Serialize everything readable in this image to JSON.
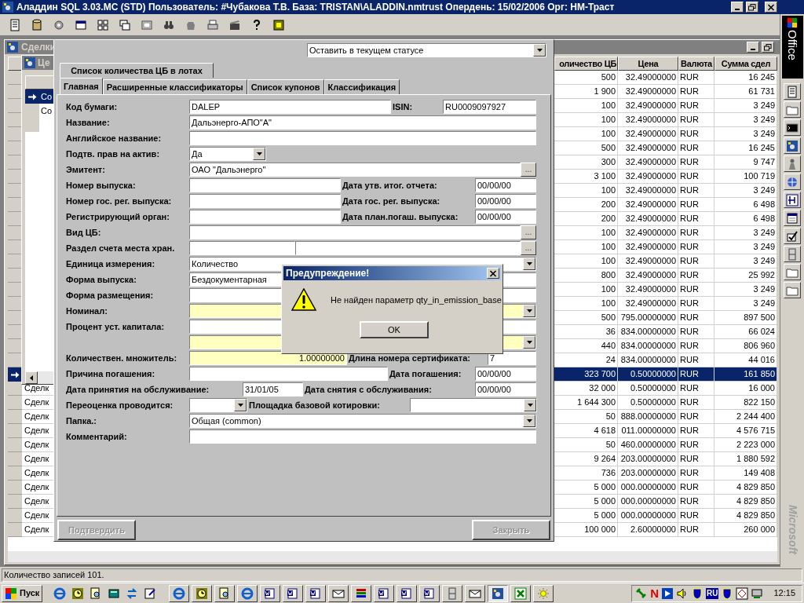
{
  "app_window": {
    "title": "Аладдин SQL 3.03.MC (STD)  Пользователь: #Чубакова Т.В. База: TRISTAN\\ALADDIN.nmtrust Опердень: 15/02/2006 Орг: НМ-Траст"
  },
  "deals_window": {
    "title": "Сделки",
    "columns": [
      "оличество ЦБ",
      "Цена",
      "Валюта",
      "Сумма сдел"
    ],
    "rows": [
      {
        "quantity": "500",
        "price": "32.49000000",
        "currency": "RUR",
        "amount": "16 245",
        "selected": false
      },
      {
        "quantity": "1 900",
        "price": "32.49000000",
        "currency": "RUR",
        "amount": "61 731",
        "selected": false
      },
      {
        "quantity": "100",
        "price": "32.49000000",
        "currency": "RUR",
        "amount": "3 249",
        "selected": false
      },
      {
        "quantity": "100",
        "price": "32.49000000",
        "currency": "RUR",
        "amount": "3 249",
        "selected": false
      },
      {
        "quantity": "100",
        "price": "32.49000000",
        "currency": "RUR",
        "amount": "3 249",
        "selected": false
      },
      {
        "quantity": "500",
        "price": "32.49000000",
        "currency": "RUR",
        "amount": "16 245",
        "selected": false
      },
      {
        "quantity": "300",
        "price": "32.49000000",
        "currency": "RUR",
        "amount": "9 747",
        "selected": false
      },
      {
        "quantity": "3 100",
        "price": "32.49000000",
        "currency": "RUR",
        "amount": "100 719",
        "selected": false
      },
      {
        "quantity": "100",
        "price": "32.49000000",
        "currency": "RUR",
        "amount": "3 249",
        "selected": false
      },
      {
        "quantity": "200",
        "price": "32.49000000",
        "currency": "RUR",
        "amount": "6 498",
        "selected": false
      },
      {
        "quantity": "200",
        "price": "32.49000000",
        "currency": "RUR",
        "amount": "6 498",
        "selected": false
      },
      {
        "quantity": "100",
        "price": "32.49000000",
        "currency": "RUR",
        "amount": "3 249",
        "selected": false
      },
      {
        "quantity": "100",
        "price": "32.49000000",
        "currency": "RUR",
        "amount": "3 249",
        "selected": false
      },
      {
        "quantity": "100",
        "price": "32.49000000",
        "currency": "RUR",
        "amount": "3 249",
        "selected": false
      },
      {
        "quantity": "800",
        "price": "32.49000000",
        "currency": "RUR",
        "amount": "25 992",
        "selected": false
      },
      {
        "quantity": "100",
        "price": "32.49000000",
        "currency": "RUR",
        "amount": "3 249",
        "selected": false
      },
      {
        "quantity": "100",
        "price": "32.49000000",
        "currency": "RUR",
        "amount": "3 249",
        "selected": false
      },
      {
        "quantity": "500",
        "price": "795.00000000",
        "currency": "RUR",
        "amount": "897 500",
        "selected": false
      },
      {
        "quantity": "36",
        "price": "834.00000000",
        "currency": "RUR",
        "amount": "66 024",
        "selected": false
      },
      {
        "quantity": "440",
        "price": "834.00000000",
        "currency": "RUR",
        "amount": "806 960",
        "selected": false
      },
      {
        "quantity": "24",
        "price": "834.00000000",
        "currency": "RUR",
        "amount": "44 016",
        "selected": false
      },
      {
        "quantity": "323 700",
        "price": "0.50000000",
        "currency": "RUR",
        "amount": "161 850",
        "selected": true
      },
      {
        "column_1": "Сделк",
        "quantity": "32 000",
        "price": "0.50000000",
        "currency": "RUR",
        "amount": "16 000",
        "selected": false
      },
      {
        "column_1": "Сделк",
        "quantity": "1 644 300",
        "price": "0.50000000",
        "currency": "RUR",
        "amount": "822 150",
        "selected": false
      },
      {
        "column_1": "Сделк",
        "quantity": "50",
        "price": "888.00000000",
        "currency": "RUR",
        "amount": "2 244 400",
        "selected": false
      },
      {
        "column_1": "Сделк",
        "quantity": "4 618",
        "price": "011.00000000",
        "currency": "RUR",
        "amount": "4 576 715",
        "selected": false
      },
      {
        "column_1": "Сделк",
        "quantity": "50",
        "price": "460.00000000",
        "currency": "RUR",
        "amount": "2 223 000",
        "selected": false
      },
      {
        "column_1": "Сделк",
        "quantity": "9 264",
        "price": "203.00000000",
        "currency": "RUR",
        "amount": "1 880 592",
        "selected": false
      },
      {
        "column_1": "Сделк",
        "quantity": "736",
        "price": "203.00000000",
        "currency": "RUR",
        "amount": "149 408",
        "selected": false
      },
      {
        "column_1": "Сделк",
        "quantity": "5 000",
        "price": "000.00000000",
        "currency": "RUR",
        "amount": "4 829 850",
        "selected": false
      },
      {
        "column_1": "Сделк",
        "quantity": "5 000",
        "price": "000.00000000",
        "currency": "RUR",
        "amount": "4 829 850",
        "selected": false
      },
      {
        "column_1": "Сделк",
        "quantity": "5 000",
        "price": "000.00000000",
        "currency": "RUR",
        "amount": "4 829 850",
        "selected": false
      },
      {
        "column_1": "Сделк",
        "quantity": "100 000",
        "price": "2.60000000",
        "currency": "RUR",
        "amount": "260 000",
        "selected": false
      }
    ]
  },
  "securities_window": {
    "title": "Це",
    "rows": [
      {
        "text": "Со",
        "selected": true
      },
      {
        "text": "Со",
        "selected": false
      }
    ]
  },
  "dialog": {
    "status_combo": "Оставить в текущем статусе",
    "tab_rows": [
      [
        {
          "label": "Список количества ЦБ в лотах",
          "selected": false
        }
      ],
      [
        {
          "label": "Главная",
          "selected": true
        },
        {
          "label": "Расширенные классификаторы",
          "selected": false
        },
        {
          "label": "Список купонов",
          "selected": false
        },
        {
          "label": "Классификация",
          "selected": false
        }
      ]
    ],
    "form_rows": [
      [
        {
          "kind": "label",
          "text": "Код бумаги:"
        },
        {
          "kind": "field",
          "value": "DALEP",
          "required": false
        },
        {
          "kind": "label",
          "text": "ISIN:"
        },
        {
          "kind": "field",
          "value": "RU0009097927",
          "required": false
        }
      ],
      [
        {
          "kind": "label",
          "text": "Название:"
        },
        {
          "kind": "field",
          "value": "Дальэнерго-АПО\"А\"",
          "required": false
        }
      ],
      [
        {
          "kind": "label",
          "text": "Английское название:"
        },
        {
          "kind": "field",
          "required": false
        }
      ],
      [
        {
          "kind": "label",
          "text": "Подтв. прав на актив:"
        },
        {
          "kind": "combo",
          "value": "Да",
          "required": false
        }
      ],
      [
        {
          "kind": "label",
          "text": "Эмитент:"
        },
        {
          "kind": "field",
          "value": "ОАО \"Дальэнерго\"",
          "required": false
        },
        {
          "kind": "browse",
          "text": "..."
        }
      ],
      [
        {
          "kind": "label",
          "text": "Номер выпуска:"
        },
        {
          "kind": "field",
          "required": false
        },
        {
          "kind": "label",
          "text": "Дата утв. итог. отчета:"
        },
        {
          "kind": "field",
          "value": "00/00/00",
          "required": false
        }
      ],
      [
        {
          "kind": "label",
          "text": "Номер гос. рег. выпуска:"
        },
        {
          "kind": "field",
          "required": false
        },
        {
          "kind": "label",
          "text": "Дата гос. рег. выпуска:"
        },
        {
          "kind": "field",
          "value": "00/00/00",
          "required": false
        }
      ],
      [
        {
          "kind": "label",
          "text": "Регистрирующий орган:"
        },
        {
          "kind": "field",
          "required": false
        },
        {
          "kind": "label",
          "text": "Дата план.погаш. выпуска:"
        },
        {
          "kind": "field",
          "value": "00/00/00",
          "required": false
        }
      ],
      [
        {
          "kind": "label",
          "text": "Вид ЦБ:"
        },
        {
          "kind": "field",
          "required": false
        },
        {
          "kind": "browse",
          "text": "..."
        }
      ],
      [
        {
          "kind": "label",
          "text": "Раздел счета места хран."
        },
        {
          "kind": "field",
          "required": false
        },
        {
          "kind": "field",
          "required": false
        },
        {
          "kind": "browse",
          "text": "..."
        }
      ],
      [
        {
          "kind": "label",
          "text": "Единица измерения:"
        },
        {
          "kind": "combo",
          "value": "Количество",
          "required": false
        }
      ],
      [
        {
          "kind": "label",
          "text": "Форма выпуска:"
        },
        {
          "kind": "field",
          "value": "Бездокументарная",
          "required": false
        }
      ],
      [
        {
          "kind": "label",
          "text": "Форма размещения:"
        },
        {
          "kind": "field",
          "required": false
        }
      ],
      [
        {
          "kind": "label",
          "text": "Номинал:"
        },
        {
          "kind": "combo",
          "required": true
        }
      ],
      [
        {
          "kind": "label",
          "text": "Процент уст. капитала:"
        },
        {
          "kind": "field",
          "required": false
        }
      ],
      [
        {
          "kind": "combo",
          "required": true
        }
      ],
      [
        {
          "kind": "label",
          "text": "Количествен. множитель:"
        },
        {
          "kind": "field",
          "value": "1.00000000",
          "right_aligned": true,
          "required": true
        },
        {
          "kind": "label",
          "text": "Длина номера сертификата:"
        },
        {
          "kind": "field",
          "value": "7",
          "required": false
        }
      ],
      [
        {
          "kind": "label",
          "text": "Причина погашения:"
        },
        {
          "kind": "field",
          "required": false
        },
        {
          "kind": "label",
          "text": "Дата погашения:"
        },
        {
          "kind": "field",
          "value": "00/00/00",
          "required": false
        }
      ],
      [
        {
          "kind": "label",
          "text": "Дата принятия на обслуживание:"
        },
        {
          "kind": "field",
          "value": "31/01/05",
          "required": false
        },
        {
          "kind": "label",
          "text": "Дата снятия с обслуживания:"
        },
        {
          "kind": "field",
          "value": "00/00/00",
          "required": false
        }
      ],
      [
        {
          "kind": "label",
          "text": "Переоценка проводится:"
        },
        {
          "kind": "combo",
          "required": false
        },
        {
          "kind": "label",
          "text": "Площадка базовой котировки:"
        },
        {
          "kind": "combo",
          "required": false
        }
      ],
      [
        {
          "kind": "label",
          "text": "Папка.:"
        },
        {
          "kind": "combo",
          "value": "Общая  (common)",
          "required": false
        }
      ],
      [
        {
          "kind": "label",
          "text": "Комментарий:"
        },
        {
          "kind": "field",
          "required": false
        }
      ]
    ],
    "buttons": [
      {
        "label": "Подтвердить",
        "disabled": true
      },
      {
        "label": "Закрыть",
        "disabled": true
      }
    ]
  },
  "message_box": {
    "title": "Предупреждение!",
    "message": "Не найден параметр qty_in_emission_base",
    "button": "OK"
  },
  "office_bar": {
    "label": "Office",
    "footer": "Microsoft"
  },
  "status_bar": {
    "text": "Количество записей 101."
  },
  "taskbar": {
    "start": "Пуск",
    "tray_badge": "N",
    "language": "RU",
    "clock": "12:15"
  }
}
